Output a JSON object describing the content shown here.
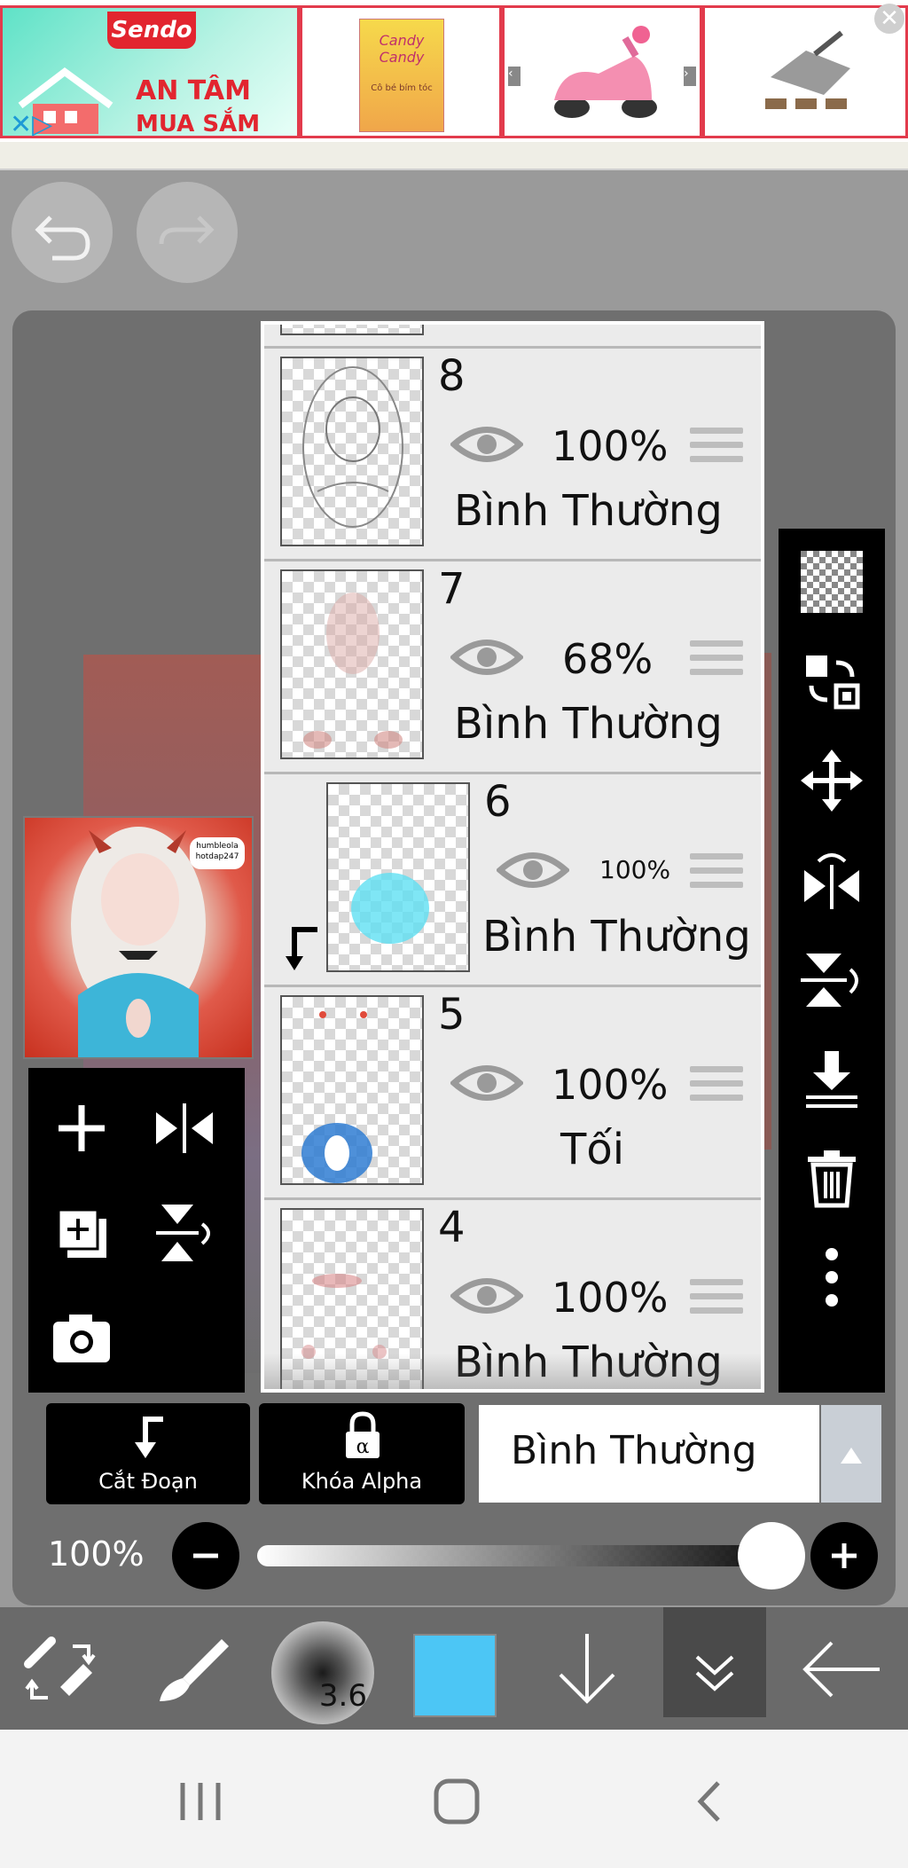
{
  "ad": {
    "brand": "Sendo",
    "line1": "AN TÂM",
    "line2": "MUA SẮM",
    "book_title": "Candy Candy",
    "book_subtitle": "Cô bé bím tóc"
  },
  "layers": [
    {
      "number": "8",
      "opacity": "100%",
      "blend": "Bình Thường"
    },
    {
      "number": "7",
      "opacity": "68%",
      "blend": "Bình Thường"
    },
    {
      "number": "6",
      "opacity": "100%",
      "blend": "Bình Thường"
    },
    {
      "number": "5",
      "opacity": "100%",
      "blend": "Tối"
    },
    {
      "number": "4",
      "opacity": "100%",
      "blend": "Bình Thường"
    }
  ],
  "preview_watermark": "humbleola hotdap247",
  "bottom": {
    "clip_label": "Cắt Đoạn",
    "alpha_label": "Khóa Alpha",
    "blend_mode": "Bình Thường",
    "opacity_label": "100%"
  },
  "toolbar": {
    "brush_size": "3.6",
    "current_color": "#4cc6f5"
  },
  "colors": {
    "layer_bg": "#ebebeb",
    "panel": "#6f6f6f",
    "toolbar": "#000000"
  }
}
